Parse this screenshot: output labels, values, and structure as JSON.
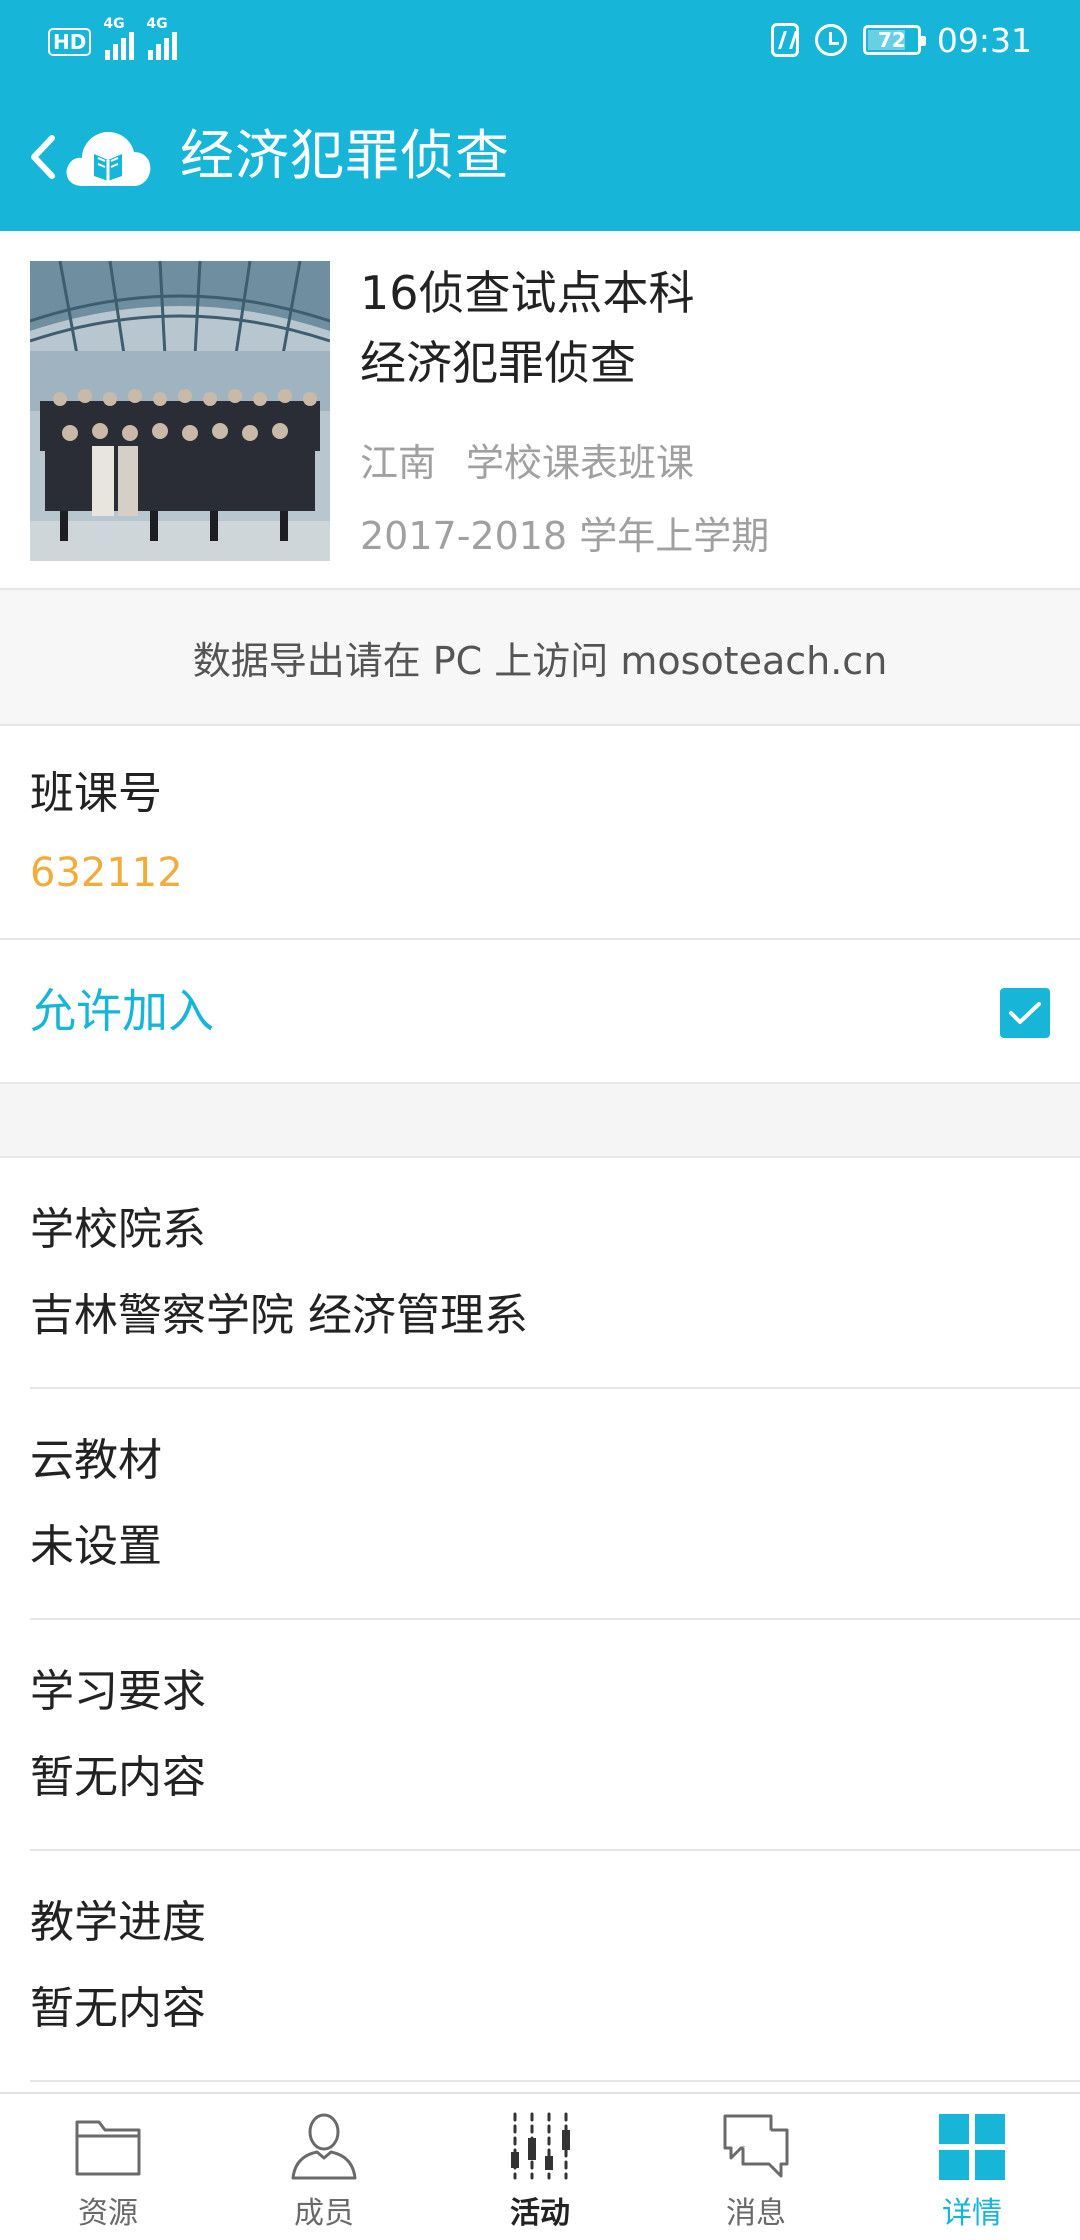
{
  "status_bar": {
    "hd": "HD",
    "network_1": "4G",
    "network_2": "4G",
    "battery": "72",
    "time": "09:31"
  },
  "app_bar": {
    "title": "经济犯罪侦查"
  },
  "course": {
    "name_line1": "16侦查试点本科",
    "name_line2": "经济犯罪侦查",
    "region": "江南",
    "course_type": "学校课表班课",
    "term": "2017-2018 学年上学期"
  },
  "export_notice": "数据导出请在 PC 上访问 mosoteach.cn",
  "class_code": {
    "label": "班课号",
    "value": "632112"
  },
  "allow_join": {
    "label": "允许加入",
    "checked": true
  },
  "info_items": [
    {
      "label": "学校院系",
      "value": "吉林警察学院  经济管理系"
    },
    {
      "label": "云教材",
      "value": "未设置"
    },
    {
      "label": "学习要求",
      "value": "暂无内容"
    },
    {
      "label": "教学进度",
      "value": "暂无内容"
    }
  ],
  "bottom_nav": [
    {
      "label": "资源",
      "icon": "folder-icon"
    },
    {
      "label": "成员",
      "icon": "person-icon"
    },
    {
      "label": "活动",
      "icon": "sliders-icon"
    },
    {
      "label": "消息",
      "icon": "chat-icon"
    },
    {
      "label": "详情",
      "icon": "grid-icon",
      "active": true
    }
  ],
  "colors": {
    "primary": "#17b6d8",
    "class_code": "#f0ad3c",
    "muted_text": "#a0a0a0"
  }
}
